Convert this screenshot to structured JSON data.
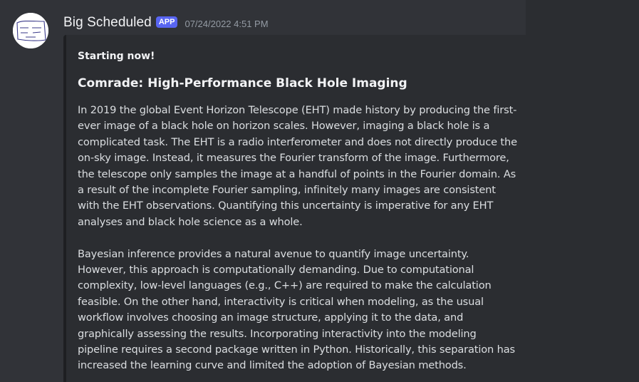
{
  "message": {
    "author": "Big Scheduled",
    "badge": "APP",
    "timestamp": "07/24/2022 4:51 PM",
    "avatar_icon": "scribble-face-avatar"
  },
  "embed": {
    "author": "Starting now!",
    "title": "Comrade: High-Performance Black Hole Imaging",
    "paragraphs": [
      "In 2019 the global Event Horizon Telescope (EHT) made history by producing the first-ever image of a black hole on horizon scales. However, imaging a black hole is a complicated task. The EHT is a radio interferometer and does not directly produce the on-sky image. Instead, it measures the Fourier transform of the image. Furthermore, the telescope only samples the image at a handful of points in the Fourier domain. As a result of the incomplete Fourier sampling, infinitely many images are consistent with the EHT observations. Quantifying this uncertainty is imperative for any EHT analyses and black hole science as a whole.",
      "Bayesian inference provides a natural avenue to quantify image uncertainty. However, this approach is computationally demanding. Due to computational complexity, low-level languages (e.g., C++) are required to make the calculation feasible. On the other hand, interactivity is critical when modeling, as the usual workflow involves choosing an image structure, applying it to the data, and graphically assessing the results. Incorporating interactivity into the modeling pipeline requires a second package written in Python. Historically, this separation has increased the learning curve and limited the adoption of Bayesian methods."
    ]
  },
  "colors": {
    "background": "#313338",
    "embed_background": "#2b2d31",
    "badge": "#5865f2",
    "timestamp": "#949ba4"
  }
}
